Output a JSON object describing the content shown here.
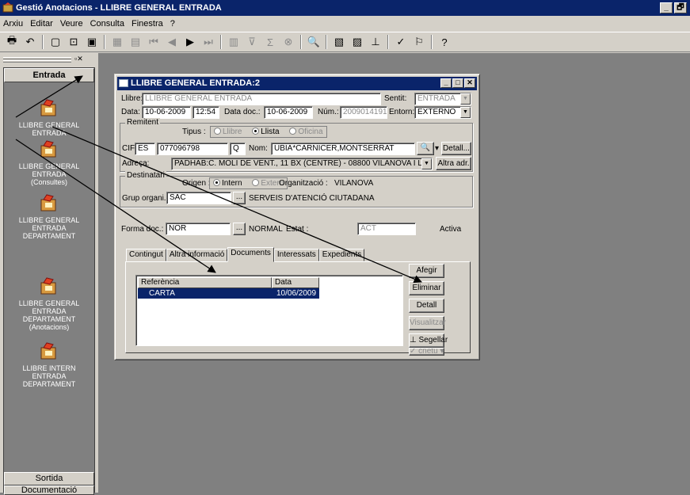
{
  "app": {
    "title": "Gestió Anotacions - LLIBRE GENERAL ENTRADA",
    "minimize": "_",
    "restore": "🗗",
    "menu": [
      "Arxiu",
      "Editar",
      "Veure",
      "Consulta",
      "Finestra",
      "?"
    ]
  },
  "toolbar": {
    "icons": [
      "printer-icon",
      "undo-icon",
      "new-icon",
      "preview-icon",
      "save-icon",
      "grid-icon",
      "list-icon",
      "first-record-icon",
      "prev-record-icon",
      "next-record-icon",
      "last-record-icon",
      "form-icon",
      "filter-icon",
      "filter-sum-icon",
      "filter-clear-icon",
      "search-icon",
      "lookup-icon",
      "attach-icon",
      "stamp-icon",
      "sign-icon",
      "stats-icon",
      "help-icon"
    ]
  },
  "sidebar": {
    "header": "Entrada",
    "items": [
      {
        "label": "LLIBRE GENERAL ENTRADA"
      },
      {
        "label": "LLIBRE GENERAL ENTRADA (Consultes)"
      },
      {
        "label": "LLIBRE GENERAL ENTRADA DEPARTAMENT"
      },
      {
        "label": "LLIBRE GENERAL ENTRADA DEPARTAMENT (Anotacions)"
      },
      {
        "label": "LLIBRE INTERN ENTRADA DEPARTAMENT"
      }
    ],
    "footer_1": "Sortida",
    "footer_2": "Documentació"
  },
  "window": {
    "title": "LLIBRE GENERAL ENTRADA:2",
    "llibre_label": "Llibre:",
    "llibre_value": "LLIBRE GENERAL ENTRADA",
    "sentit_label": "Sentit:",
    "sentit_value": "ENTRADA",
    "data_label": "Data:",
    "data_value": "10-06-2009",
    "hora_value": "12:54",
    "datadoc_label": "Data doc.:",
    "datadoc_value": "10-06-2009",
    "num_label": "Núm.:",
    "num_value": "2009014191",
    "entorn_label": "Entorn:",
    "entorn_value": "EXTERNO",
    "remitent": {
      "group_title": "Remitent",
      "tipus_label": "Tipus :",
      "tipus_options": [
        "Llibre",
        "Llista",
        "Oficina"
      ],
      "cif_label": "CIF",
      "cif_country": "ES",
      "cif_number": "077096798",
      "cif_letter": "Q",
      "nom_label": "Nom:",
      "nom_value": "UBIA*CARNICER,MONTSERRAT",
      "detall_button": "Detall...",
      "adreca_label": "Adreça:",
      "adreca_value": "PADHAB:C. MOLI DE VENT., 11 BX (CENTRE) - 08800 VILANOVA I LA GELTRÚ",
      "altra_button": "Altra adr."
    },
    "destinatari": {
      "group_title": "Destinatari",
      "origen_label": "Origen :",
      "origen_options": [
        "Intern",
        "Extern"
      ],
      "organitzacio_label": "Organització :",
      "organitzacio_value": "VILANOVA",
      "grup_label": "Grup organi. :",
      "grup_code": "SAC",
      "grup_name": "SERVEIS D'ATENCIÓ CIUTADANA"
    },
    "forma_label": "Forma doc.:",
    "forma_code": "NOR",
    "forma_name": "NORMAL",
    "estat_label": "Estat :",
    "estat_value": "ACT",
    "estat_desc": "Activa",
    "lookup_dots": "...",
    "tabs": [
      "Contingut",
      "Altra informació",
      "Documents",
      "Interessats",
      "Expedients"
    ],
    "grid_headers": [
      "Referència",
      "Data"
    ],
    "grid_row": {
      "ref": "CARTA",
      "date": "10/06/2009"
    },
    "buttons": {
      "afegir": "Afegir",
      "eliminar": "Eliminar",
      "detall": "Detall",
      "visualitzar": "Visualitzar",
      "segellar": "Segellar",
      "cnetu": "cnetu"
    }
  },
  "colors": {
    "titlebar": "#0a246a",
    "face": "#d4d0c8",
    "desktop": "#808080"
  }
}
